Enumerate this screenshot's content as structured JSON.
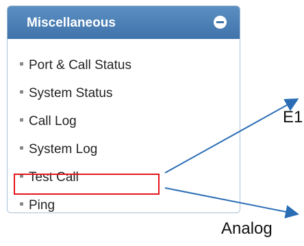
{
  "panel": {
    "title": "Miscellaneous",
    "collapse_icon": "minus-circle-icon",
    "items": [
      {
        "label": "Port & Call Status"
      },
      {
        "label": "System Status"
      },
      {
        "label": "Call Log"
      },
      {
        "label": "System Log"
      },
      {
        "label": "Test Call",
        "highlighted": true
      },
      {
        "label": "Ping"
      }
    ]
  },
  "annotations": {
    "label_top": "E1",
    "label_bottom": "Analog",
    "highlight_color": "#e3141b",
    "arrow_color": "#2a6db5"
  }
}
